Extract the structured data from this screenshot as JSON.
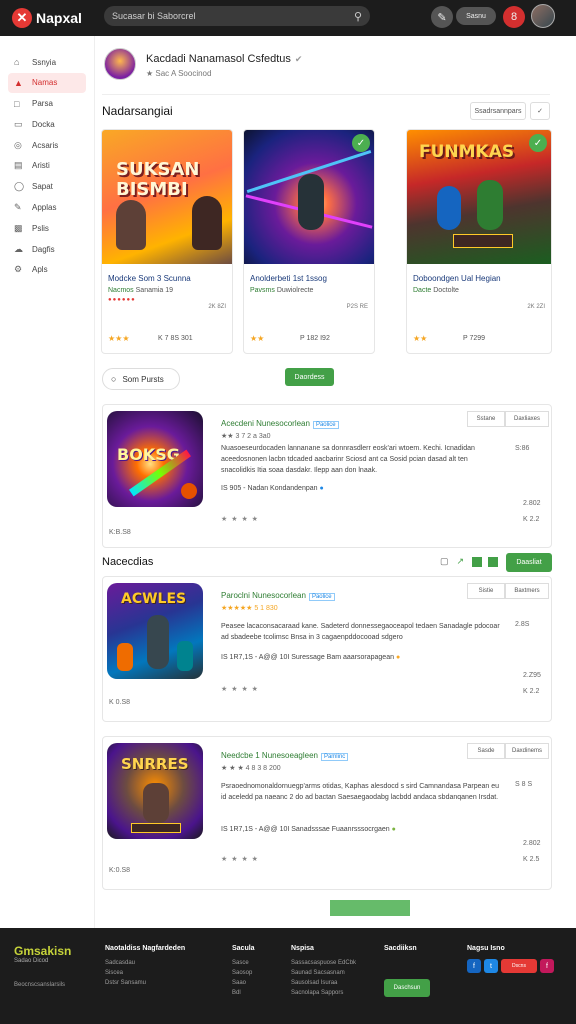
{
  "app": {
    "logo_glyph": "✕",
    "name": "Napxal"
  },
  "search": {
    "placeholder": "Sucasar bi Saborcrel",
    "icon": "search-icon"
  },
  "topbar": {
    "pill_label": "Sasnu",
    "notif_count": "8"
  },
  "sidebar": {
    "items": [
      {
        "label": "Ssnyia",
        "icon": "home-icon",
        "active": false
      },
      {
        "label": "Namas",
        "icon": "flame-icon",
        "active": true
      },
      {
        "label": "Parsa",
        "icon": "bookmark-icon",
        "active": false
      },
      {
        "label": "Docka",
        "icon": "folder-icon",
        "active": false
      },
      {
        "label": "Acsaris",
        "icon": "globe-icon",
        "active": false
      },
      {
        "label": "Aristi",
        "icon": "doc-icon",
        "active": false
      },
      {
        "label": "Sapat",
        "icon": "chat-icon",
        "active": false
      },
      {
        "label": "Applas",
        "icon": "edit-icon",
        "active": false
      },
      {
        "label": "Pslis",
        "icon": "grid-icon",
        "active": false
      },
      {
        "label": "Dagfis",
        "icon": "cloud-icon",
        "active": false
      },
      {
        "label": "Apls",
        "icon": "settings-icon",
        "active": false
      }
    ]
  },
  "profile": {
    "name": "Kacdadi Nanamasol Csfedtus",
    "sub": "★ Sac A Soocinod"
  },
  "featured": {
    "title": "Nadarsangiai",
    "button": "Ssadrsannpars",
    "chevron": "✓",
    "cards": [
      {
        "title": "Modcke Som 3 Scunna",
        "sub_green": "Nacmos",
        "sub_rest": "Sanamia 19",
        "meta": "2K 8ZI",
        "stars": "★★★",
        "count": "K 7 8S 301",
        "img_text": "SUKSAN BISMBI",
        "checked": false
      },
      {
        "title": "Anolderbeti 1st 1ssog",
        "sub_green": "Pavsms",
        "sub_rest": "Duwiolrecte",
        "meta": "P2S RE",
        "stars": "★★",
        "count": "P 182 I92",
        "img_text": "",
        "checked": true
      },
      {
        "title": "Doboondgen Ual Hegian",
        "sub_green": "Dacte",
        "sub_rest": "Doctolte",
        "meta": "2K 2ZI",
        "stars": "★★",
        "count": "P 7299",
        "img_text": "FUNMKAS",
        "checked": true
      }
    ]
  },
  "sort": {
    "label": "Som Pursts",
    "icon": "sort-icon",
    "green_button": "Daordess"
  },
  "list1": {
    "title": "Acecdeni Nunesocorlean",
    "tag": "Paolice",
    "sub": "★★ 3 7 2 a 3a0",
    "desc": "Nuasoeseurdocaden lannanane sa donnrasdlerr eosk'ari wtoem. Kechi. Icnadidan aceedosnonen lacbn tdcaded aacbarinr Sciosd ant ca Sosid pcian dasad alt ten snacolidkis Itia soaa dasdakr. Ilepp aan don lnaak.",
    "meta": "IS 905 - Nadan Kondandenpan",
    "stars": "★ ★ ★ ★",
    "btn1": "Sstane",
    "btn2": "Daxliaxes",
    "right1": "S:86",
    "right2": "2.802",
    "right3": "K 2.2",
    "left_small": "K:B.S8",
    "img_text": "BOKSG"
  },
  "section2": {
    "title": "Nacecdias",
    "button": "Daasliat"
  },
  "list2": {
    "title": "Paroclni Nunesocorlean",
    "tag": "Paolice",
    "sub": "★★★★★ 5 1 830",
    "desc": "Peasee lacaconsacaraad kane. Sadeterd donnessegaoceapol tedaen Sanadagle pdocoar ad sbadeebe tcolimsc Bnsa in 3 cagaenpddocooad sdgero",
    "meta": "IS 1R7,1S - A@@ 10I Suressage Bam aaarsorapagean",
    "stars": "★ ★ ★ ★",
    "btn1": "Sistie",
    "btn2": "Baxtmers",
    "right1": "2.8S",
    "right2": "2.Z95",
    "right3": "K 2.2",
    "left_small": "K 0.S8",
    "img_text": "ACWLES"
  },
  "list3": {
    "title": "Needcbe 1 Nunesoeagleen",
    "tag": "Pamlinc",
    "sub": "★ ★ ★ 4 8 3 8 200",
    "desc": "Psraoednomonaldornuegp'arms otidas, Kaphas alesdocd s sird Camnandasa Parpean eu id aceledd pa naeanc 2 do ad bactan Saesaegaodabg lacbdd andaca sbdanqanen Irsdat.",
    "meta": "IS 1R7,1S - A@@ 10I Sanadsssae Fuaanrsssocrgaen",
    "stars": "★ ★ ★ ★",
    "btn1": "Sasde",
    "btn2": "Daxdinems",
    "right1": "S 8 S",
    "right2": "2.802",
    "right3": "K 2.5",
    "left_small": "K:0.S8",
    "img_text": "SNRRES"
  },
  "footer": {
    "brand": "Gmsakisn",
    "brand_sub": "Sadao Dicod",
    "brand_link": "Beocnscsanslarsils",
    "cols": [
      {
        "title": "Naotaldiss Nagfardeden",
        "links": [
          "Sadcasdau",
          "Siscea",
          "Dstsr Sansamu"
        ]
      },
      {
        "title": "Sacula",
        "links": [
          "Sasce",
          "Saosop",
          "Saao",
          "Bdl"
        ]
      },
      {
        "title": "Nspisa",
        "links": [
          "Sassacsaspuose EdCbk",
          "Saunad Sacsasnam",
          "Sausolsad Isuraa",
          "Sacnolapa Sappors"
        ]
      },
      {
        "title": "Sacdiiksn",
        "links": []
      },
      {
        "title": "Nagsu Isno",
        "links": []
      }
    ],
    "green_button": "Daschsun",
    "social": [
      "f",
      "t",
      "Dscns",
      "f"
    ]
  }
}
